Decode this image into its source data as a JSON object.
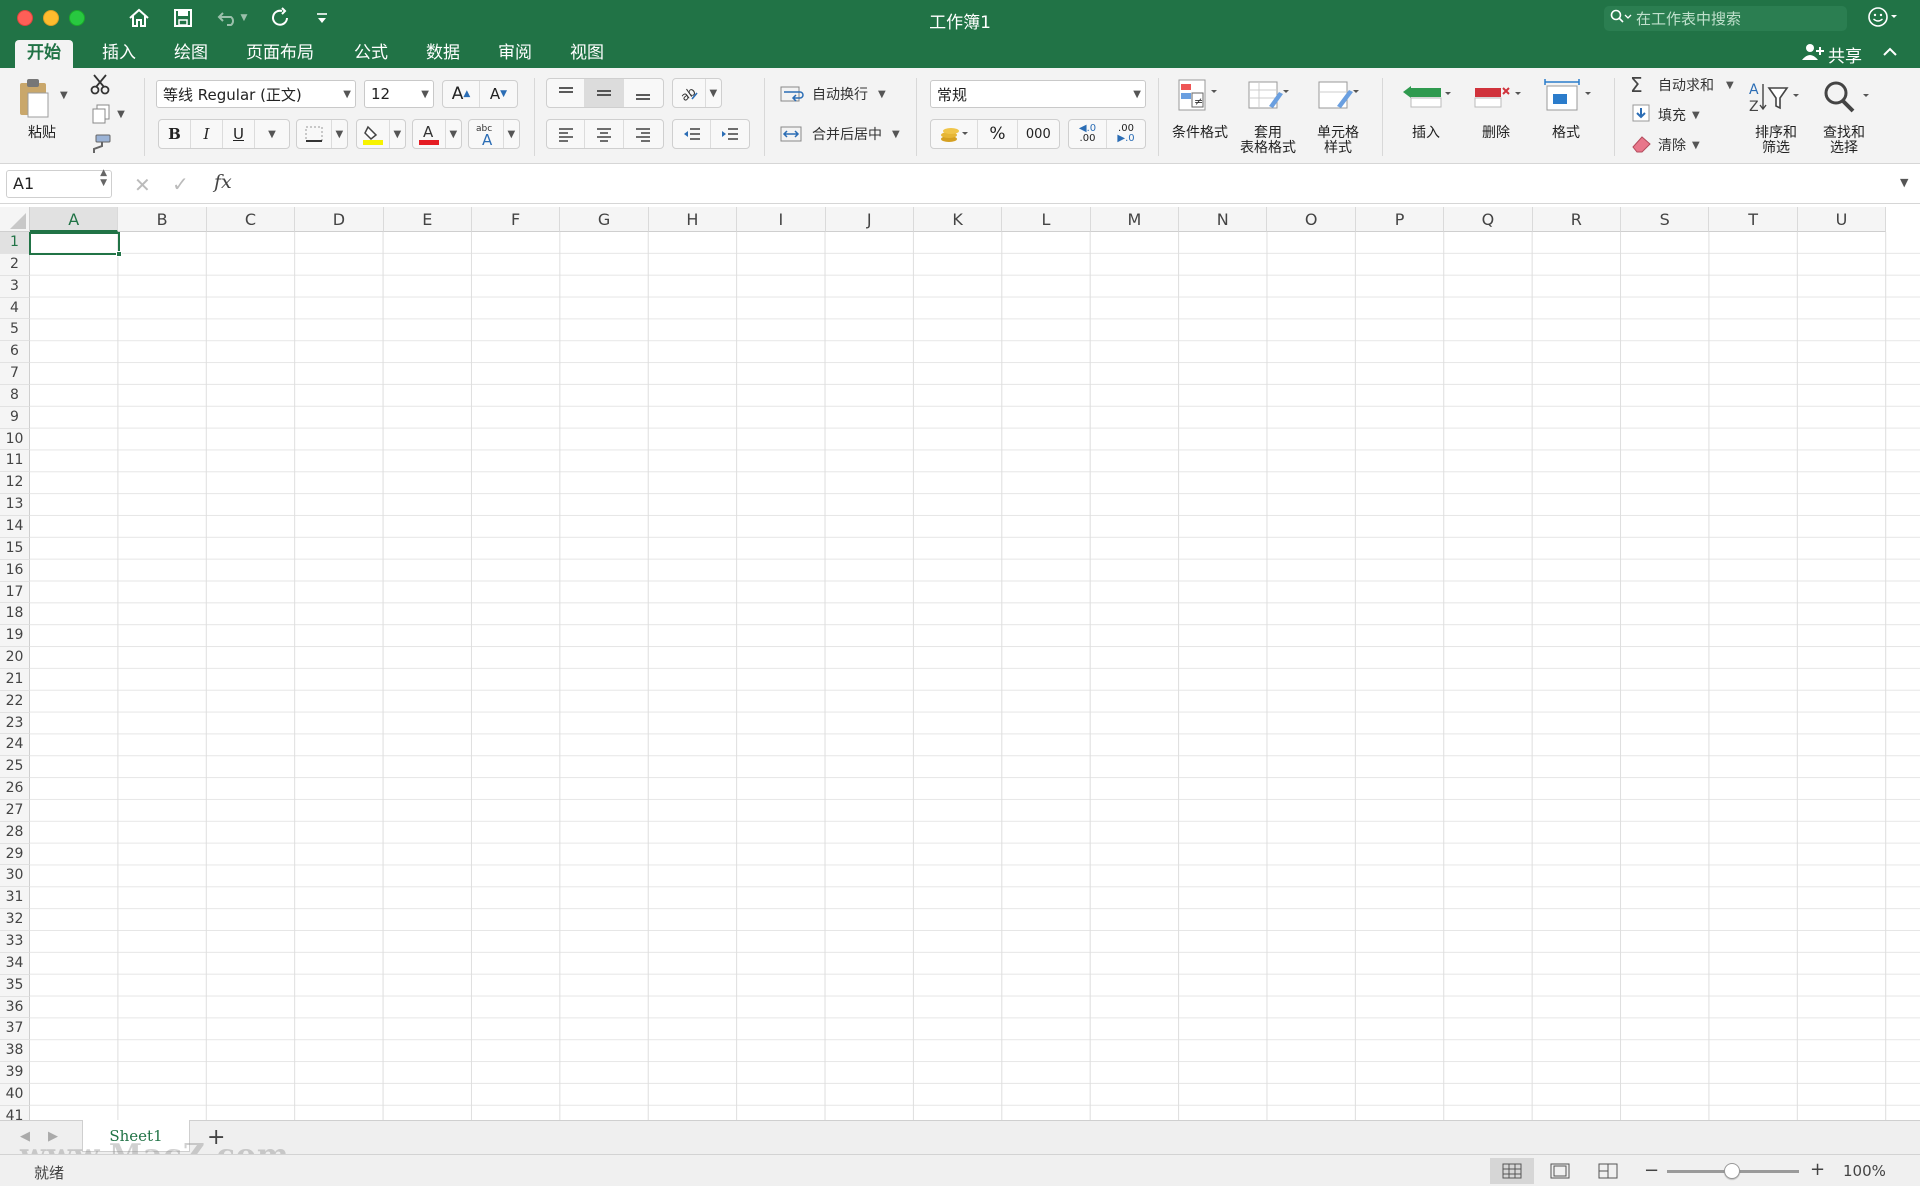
{
  "window": {
    "title": "工作簿1"
  },
  "search": {
    "placeholder": "在工作表中搜索"
  },
  "tabs": [
    {
      "label": "开始",
      "active": true
    },
    {
      "label": "插入"
    },
    {
      "label": "绘图"
    },
    {
      "label": "页面布局"
    },
    {
      "label": "公式"
    },
    {
      "label": "数据"
    },
    {
      "label": "审阅"
    },
    {
      "label": "视图"
    }
  ],
  "share_label": "共享",
  "ribbon": {
    "paste_label": "粘贴",
    "font_name": "等线 Regular (正文)",
    "font_size": "12",
    "bold": "B",
    "italic": "I",
    "underline": "U",
    "wrap_text": "自动换行",
    "merge_center": "合并后居中",
    "number_format": "常规",
    "percent": "%",
    "thousands": "000",
    "inc_decimal": ".00",
    "dec_decimal": ".00",
    "conditional_format": "条件格式",
    "table_format_1": "套用",
    "table_format_2": "表格格式",
    "cell_style_1": "单元格",
    "cell_style_2": "样式",
    "insert": "插入",
    "delete": "删除",
    "format": "格式",
    "autosum": "自动求和",
    "fill": "填充",
    "clear": "清除",
    "sort_1": "排序和",
    "sort_2": "筛选",
    "find_1": "查找和",
    "find_2": "选择"
  },
  "formula_bar": {
    "name_box": "A1",
    "fx": "fx",
    "value": ""
  },
  "columns": [
    "A",
    "B",
    "C",
    "D",
    "E",
    "F",
    "G",
    "H",
    "I",
    "J",
    "K",
    "L",
    "M",
    "N",
    "O",
    "P",
    "Q",
    "R",
    "S",
    "T",
    "U"
  ],
  "rows": [
    "1",
    "2",
    "3",
    "4",
    "5",
    "6",
    "7",
    "8",
    "9",
    "10",
    "11",
    "12",
    "13",
    "14",
    "15",
    "16",
    "17",
    "18",
    "19",
    "20",
    "21",
    "22",
    "23",
    "24",
    "25",
    "26",
    "27",
    "28",
    "29",
    "30",
    "31",
    "32",
    "33",
    "34",
    "35",
    "36",
    "37",
    "38",
    "39",
    "40",
    "41"
  ],
  "selected_cell": "A1",
  "sheets": [
    {
      "label": "Sheet1",
      "active": true
    }
  ],
  "status": {
    "text": "就绪",
    "zoom": "100%"
  },
  "watermark": "www.MacZ.com",
  "colors": {
    "accent": "#217346",
    "ribbon_bg": "#f3f3f3"
  },
  "icons": [
    "home-icon",
    "save-icon",
    "undo-icon",
    "redo-icon",
    "customize-icon",
    "search-icon",
    "smiley-icon",
    "share-icon",
    "cut-icon",
    "copy-icon",
    "format-painter-icon",
    "paste-icon"
  ]
}
